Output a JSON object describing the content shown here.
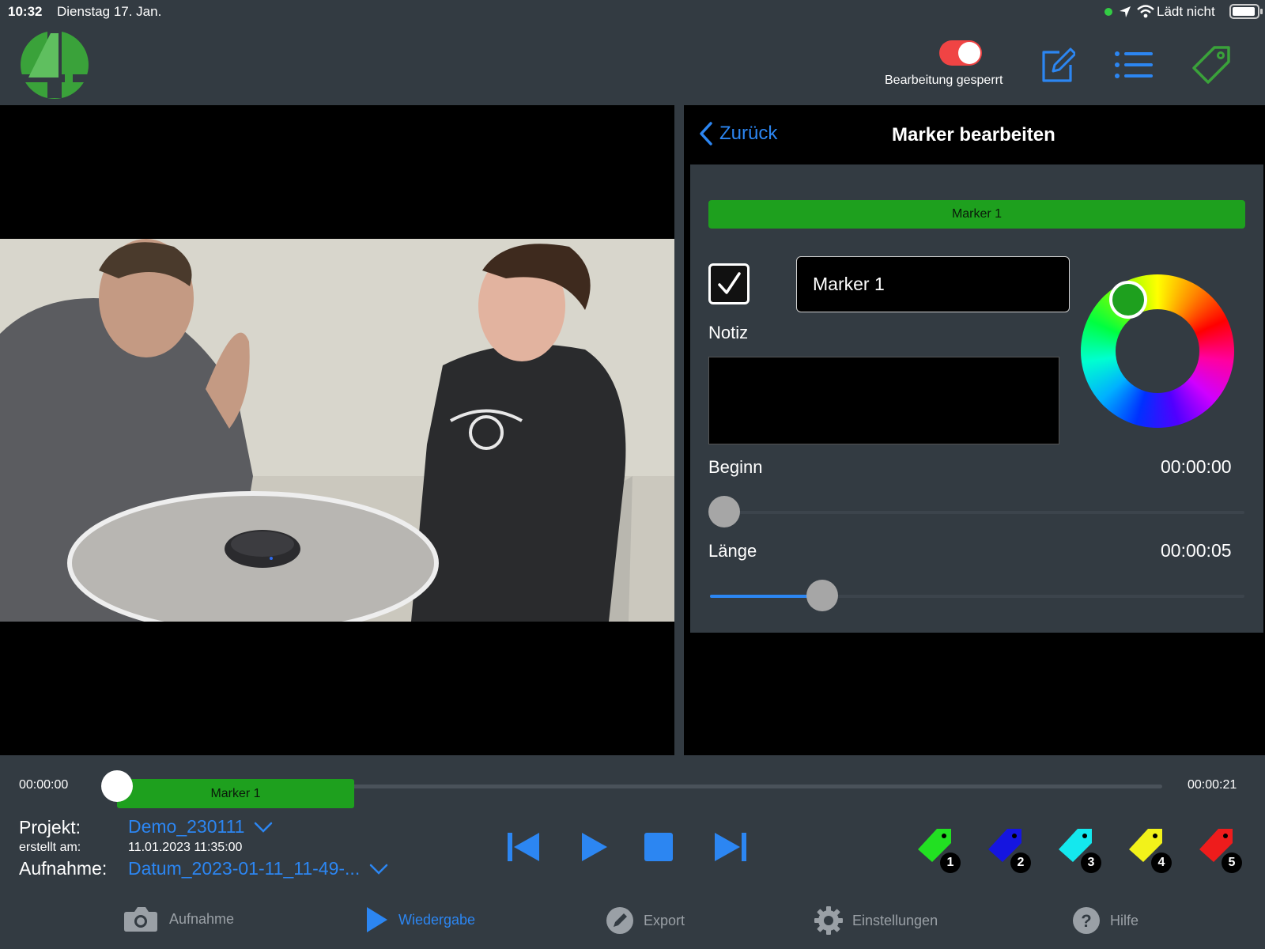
{
  "status_bar": {
    "time": "10:32",
    "date": "Dienstag 17. Jan.",
    "charging": "Lädt nicht"
  },
  "top_bar": {
    "lock_label": "Bearbeitung gesperrt",
    "lock_on": true,
    "accent_color": "#2c86f2",
    "brand_color": "#3aa23a"
  },
  "editor": {
    "back_label": "Zurück",
    "title": "Marker bearbeiten",
    "banner_label": "Marker 1",
    "checkbox_checked": true,
    "name_value": "Marker 1",
    "note_label": "Notiz",
    "note_value": "",
    "begin_label": "Beginn",
    "begin_value": "00:00:00",
    "length_label": "Länge",
    "length_value": "00:00:05",
    "marker_color": "#1ea01e"
  },
  "timeline": {
    "start_time": "00:00:00",
    "end_time": "00:00:21",
    "marker_label": "Marker 1"
  },
  "info": {
    "project_key": "Projekt:",
    "project_value": "Demo_230111",
    "created_key": "erstellt am:",
    "created_value": "11.01.2023 11:35:00",
    "recording_key": "Aufnahme:",
    "recording_value": "Datum_2023-01-11_11-49-..."
  },
  "marker_tags": [
    {
      "num": "1",
      "color": "#22e022"
    },
    {
      "num": "2",
      "color": "#1515e0"
    },
    {
      "num": "3",
      "color": "#14e8ee"
    },
    {
      "num": "4",
      "color": "#f2f21a"
    },
    {
      "num": "5",
      "color": "#ee1c1c"
    }
  ],
  "tabs": [
    {
      "label": "Aufnahme",
      "icon": "camera-icon",
      "active": false
    },
    {
      "label": "Wiedergabe",
      "icon": "play-icon",
      "active": true
    },
    {
      "label": "Export",
      "icon": "pencil-icon",
      "active": false
    },
    {
      "label": "Einstellungen",
      "icon": "gear-icon",
      "active": false
    },
    {
      "label": "Hilfe",
      "icon": "help-icon",
      "active": false
    }
  ]
}
